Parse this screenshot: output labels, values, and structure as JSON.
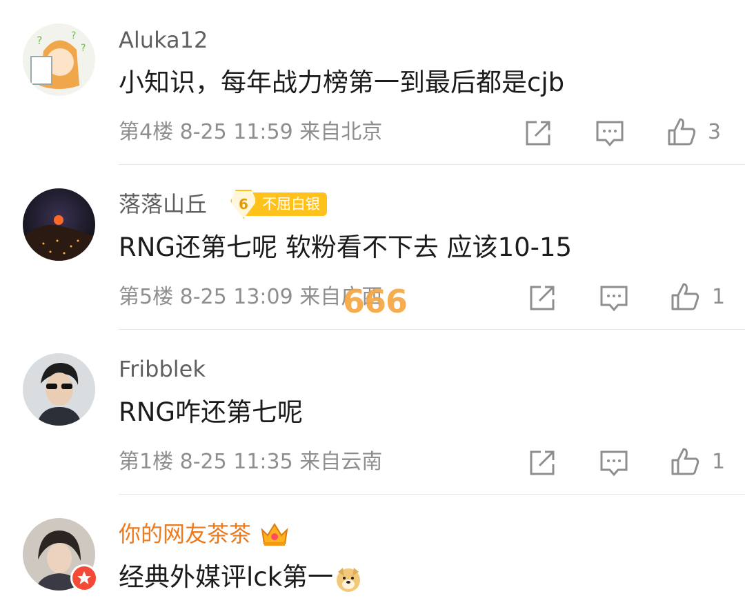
{
  "comments": [
    {
      "author": "Aluka12",
      "text": "小知识，每年战力榜第一到最后都是cjb",
      "floor": "第4楼",
      "time": "8-25 11:59",
      "location": "来自北京",
      "likes": "3"
    },
    {
      "author": "落落山丘",
      "badge_level": "6",
      "badge_label": "不屈白银",
      "text": "RNG还第七呢 软粉看不下去 应该10-15",
      "floor": "第5楼",
      "time": "8-25 13:09",
      "location": "来自广西",
      "likes": "1"
    },
    {
      "author": "Fribblek",
      "text": "RNG咋还第七呢",
      "floor": "第1楼",
      "time": "8-25 11:35",
      "location": "来自云南",
      "likes": "1"
    },
    {
      "author": "你的网友茶茶",
      "text": "经典外媒评lck第一",
      "author_color": "#ee7a1c"
    }
  ],
  "overlay_text": "666",
  "icons": [
    "share-icon",
    "comment-icon",
    "like-icon",
    "crown-icon",
    "doge-emoji-icon",
    "verified-badge-icon"
  ]
}
